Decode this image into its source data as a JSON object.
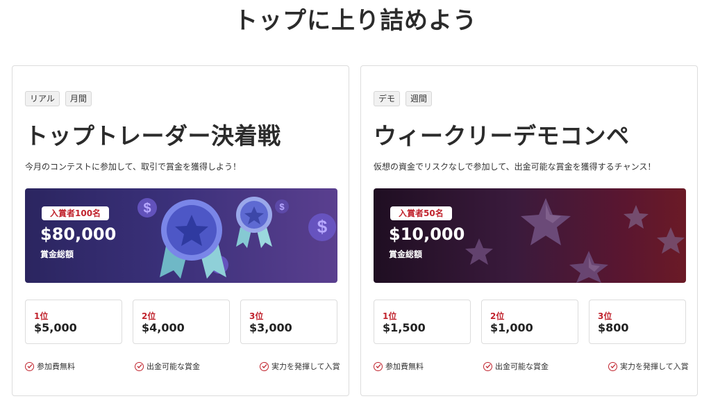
{
  "page": {
    "title": "トップに上り詰めよう"
  },
  "colors": {
    "accent": "#c0232d",
    "border": "#dcdcdc",
    "tag_bg": "#f1f1f1"
  },
  "cards": [
    {
      "tags": [
        "リアル",
        "月間"
      ],
      "title": "トップトレーダー決着戦",
      "description": "今月のコンテストに参加して、取引で賞金を獲得しよう！",
      "banner": {
        "winners": "入賞者100名",
        "amount": "$80,000",
        "label": "賞金総額",
        "theme": "blue-medals-dollars"
      },
      "ranks": [
        {
          "place": "1位",
          "prize": "$5,000"
        },
        {
          "place": "2位",
          "prize": "$4,000"
        },
        {
          "place": "3位",
          "prize": "$3,000"
        }
      ],
      "features": [
        "参加費無料",
        "出金可能な賞金",
        "実力を発揮して入賞"
      ]
    },
    {
      "tags": [
        "デモ",
        "週間"
      ],
      "title": "ウィークリーデモコンペ",
      "description": "仮想の資金でリスクなしで参加して、出金可能な賞金を獲得するチャンス！",
      "banner": {
        "winners": "入賞者50名",
        "amount": "$10,000",
        "label": "賞金総額",
        "theme": "dark-red-stars"
      },
      "ranks": [
        {
          "place": "1位",
          "prize": "$1,500"
        },
        {
          "place": "2位",
          "prize": "$1,000"
        },
        {
          "place": "3位",
          "prize": "$800"
        }
      ],
      "features": [
        "参加費無料",
        "出金可能な賞金",
        "実力を発揮して入賞"
      ]
    }
  ]
}
